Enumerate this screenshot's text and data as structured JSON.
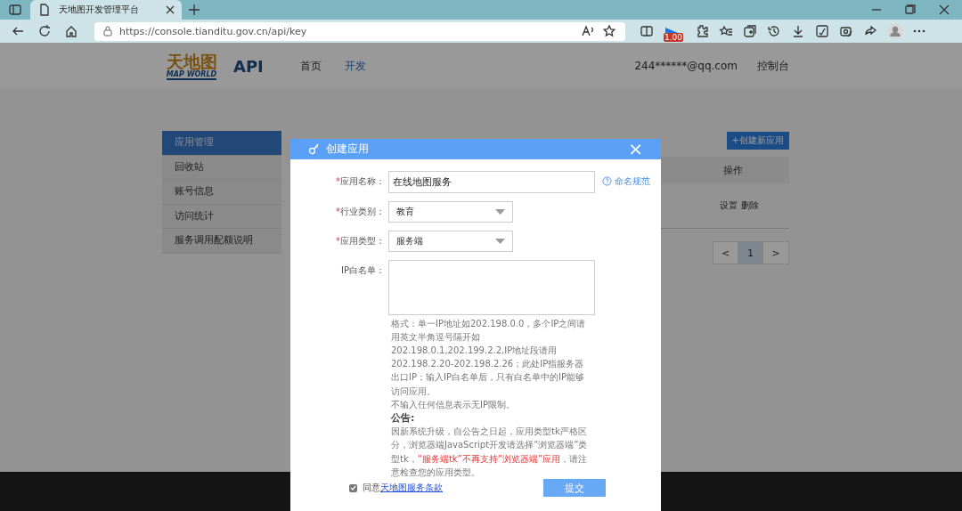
{
  "browser": {
    "tab_title": "天地图开发管理平台",
    "url": "https://console.tianditu.gov.cn/api/key",
    "zoom_badge": "1.00"
  },
  "header": {
    "logo_title": "天地图",
    "logo_subtitle": "MAP WORLD",
    "product": "API",
    "nav": [
      {
        "label": "首页",
        "selected": false
      },
      {
        "label": "开发",
        "selected": true
      }
    ],
    "user": "244******@qq.com",
    "console_link": "控制台"
  },
  "sidebar": {
    "items": [
      {
        "label": "应用管理",
        "selected": true
      },
      {
        "label": "回收站",
        "selected": false
      },
      {
        "label": "账号信息",
        "selected": false
      },
      {
        "label": "访问统计",
        "selected": false
      },
      {
        "label": "服务调用配额说明",
        "selected": false
      }
    ]
  },
  "content": {
    "create_button": "+创建新应用",
    "table": {
      "columns": [
        "操作"
      ],
      "row_actions": [
        "设置",
        "删除"
      ]
    },
    "pagination": {
      "prev": "<",
      "pages": [
        {
          "label": "1",
          "selected": true
        }
      ],
      "next": ">"
    }
  },
  "dialog": {
    "title": "创建应用",
    "close": "×",
    "required_mark": "*",
    "fields": [
      {
        "kind": "text",
        "label": "应用名称：",
        "required": true,
        "value": "在线地图服务",
        "help": "命名规范"
      },
      {
        "kind": "select",
        "label": "行业类别：",
        "required": true,
        "value": "教育"
      },
      {
        "kind": "select",
        "label": "应用类型：",
        "required": true,
        "value": "服务端"
      },
      {
        "kind": "textarea",
        "label": "IP白名单：",
        "required": false
      }
    ],
    "notes": [
      "格式：单一IP地址如202.198.0.0，多个IP之间请用英文半角逗号隔开如202.198.0.1,202.199.2.2,IP地址段请用202.198.2.20-202.198.2.26；此处IP指服务器出口IP；输入IP白名单后，只有白名单中的IP能够访问应用。",
      "不输入任何信息表示无IP限制。"
    ],
    "notice_title": "公告:",
    "notice": [
      {
        "kind": "normal",
        "text": "因新系统升级，自公告之日起，应用类型tk严格区分，浏览器端JavaScript开发请选择“浏览器端”类型tk，"
      },
      {
        "kind": "warning",
        "text": "“服务端tk”不再支持“浏览器端”应用"
      },
      {
        "kind": "normal",
        "text": "，请注意检查您的应用类型。"
      }
    ],
    "agree": {
      "checked": true,
      "label": "同意",
      "link": "天地图服务条款"
    },
    "submit": "提交"
  }
}
